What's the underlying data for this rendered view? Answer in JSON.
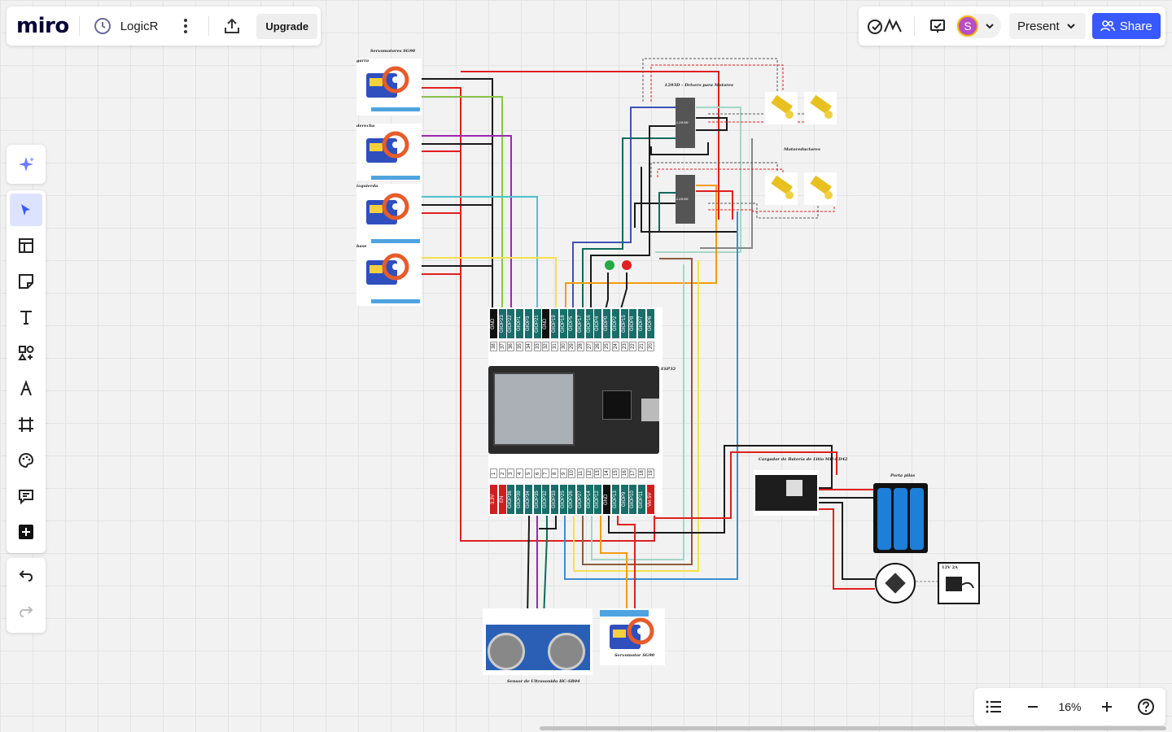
{
  "app": {
    "logo": "miro",
    "board_name": "LogicR",
    "upgrade_label": "Upgrade"
  },
  "header_right": {
    "avatar_initial": "S",
    "present_label": "Present",
    "share_label": "Share"
  },
  "left_toolbar": {
    "tools": [
      "select-tool",
      "templates-tool",
      "sticky-note-tool",
      "text-tool",
      "shapes-tool",
      "pen-tool",
      "frame-tool",
      "stickers-tool",
      "comment-tool",
      "more-apps-tool"
    ],
    "history": [
      "undo",
      "redo"
    ]
  },
  "zoom": {
    "level": "16%"
  },
  "diagram": {
    "servos_title": "Servomotores SG90",
    "servo_labels": [
      "garra",
      "derecha",
      "izquierda",
      "base"
    ],
    "driver_title": "L293D – Drivers para Motores",
    "driver_chip_labels": [
      "L293D",
      "L293D"
    ],
    "motors_title": "Motoreductores",
    "motor_labels": [
      "Motoreductor",
      "Motoreductor",
      "Motoreductor",
      "Motoreductor"
    ],
    "esp_label": "ESP32",
    "top_pins": [
      "GND",
      "GIOP23",
      "GIOP22",
      "GIOP1",
      "GIOP3",
      "GIOP21",
      "GND",
      "GIOP19",
      "GIOP18",
      "GIOP5",
      "GIOP17",
      "GIOP16",
      "GIOP4",
      "GIOP0",
      "GIOP2",
      "GIOP15",
      "GIOP8",
      "GIOP7",
      "GIOP6"
    ],
    "top_pin_numbers": [
      "38",
      "37",
      "36",
      "35",
      "34",
      "33",
      "32",
      "31",
      "30",
      "29",
      "28",
      "27",
      "26",
      "25",
      "24",
      "23",
      "22",
      "21",
      "20"
    ],
    "bottom_pins": [
      "3.3V",
      "EN",
      "GIOP36",
      "GIOP39",
      "GIOP34",
      "GIOP35",
      "GIOP32",
      "GIOP33",
      "GIOP25",
      "GIOP26",
      "GIOP27",
      "GIOP14",
      "GIOP12",
      "GND",
      "GIOP13",
      "GIOP9",
      "GIOP10",
      "GIOP11",
      "Vin 5V"
    ],
    "bottom_pin_numbers": [
      "1",
      "2",
      "3",
      "4",
      "5",
      "6",
      "7",
      "8",
      "9",
      "10",
      "11",
      "12",
      "13",
      "14",
      "15",
      "16",
      "17",
      "18",
      "19"
    ],
    "charger_title": "Cargador de Batería de Litio MH-CD42",
    "battery_title": "Porta pilas",
    "adapter_label": "12V 2A",
    "ultrasonic_title": "Sensor de Ultrasonido HC-SR04",
    "bottom_servo_title": "Servomotor SG90"
  },
  "colors": {
    "accent": "#3859ff",
    "wire_red": "#e02020",
    "wire_black": "#1a1a1a"
  }
}
